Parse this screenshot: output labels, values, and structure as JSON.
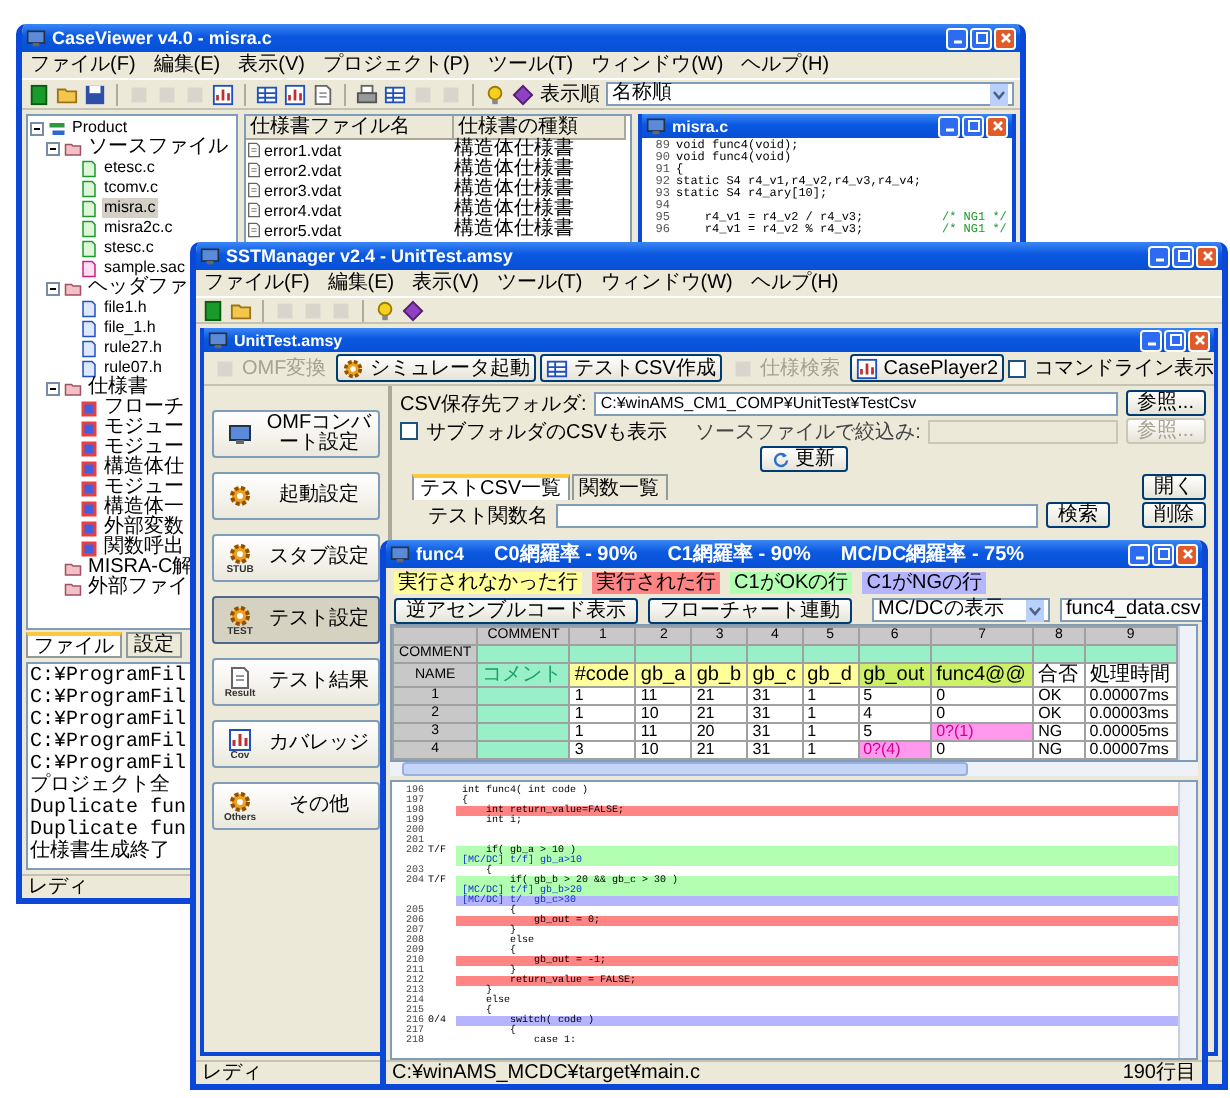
{
  "case_viewer": {
    "title": "CaseViewer v4.0 - misra.c",
    "menu": [
      "ファイル(F)",
      "編集(E)",
      "表示(V)",
      "プロジェクト(P)",
      "ツール(T)",
      "ウィンドウ(W)",
      "ヘルプ(H)"
    ],
    "sort": {
      "label": "表示順",
      "value": "名称順"
    },
    "tree": [
      {
        "label": "Product",
        "kind": "project",
        "expanded": true,
        "selected": false,
        "children": [
          {
            "label": "ソースファイル",
            "kind": "folder",
            "expanded": true,
            "selected": false,
            "children": [
              {
                "label": "etesc.c",
                "kind": "source",
                "selected": false
              },
              {
                "label": "tcomv.c",
                "kind": "source",
                "selected": false
              },
              {
                "label": "misra.c",
                "kind": "source",
                "selected": true
              },
              {
                "label": "misra2c.c",
                "kind": "source",
                "selected": false
              },
              {
                "label": "stesc.c",
                "kind": "source",
                "selected": false
              },
              {
                "label": "sample.sac",
                "kind": "sample",
                "selected": false
              }
            ]
          },
          {
            "label": "ヘッダファ",
            "kind": "folder",
            "expanded": true,
            "selected": false,
            "children": [
              {
                "label": "file1.h",
                "kind": "header",
                "selected": false
              },
              {
                "label": "file_1.h",
                "kind": "header",
                "selected": false
              },
              {
                "label": "rule27.h",
                "kind": "header",
                "selected": false
              },
              {
                "label": "rule07.h",
                "kind": "header",
                "selected": false
              }
            ]
          },
          {
            "label": "仕様書",
            "kind": "folder",
            "expanded": true,
            "selected": false,
            "children": [
              {
                "label": "フローチ",
                "kind": "spec",
                "selected": false
              },
              {
                "label": "モジュー",
                "kind": "spec",
                "selected": false
              },
              {
                "label": "モジュー",
                "kind": "spec",
                "selected": false
              },
              {
                "label": "構造体仕",
                "kind": "spec",
                "selected": false
              },
              {
                "label": "モジュー",
                "kind": "spec",
                "selected": false
              },
              {
                "label": "構造体一",
                "kind": "spec",
                "selected": false
              },
              {
                "label": "外部変数",
                "kind": "spec",
                "selected": false
              },
              {
                "label": "関数呼出",
                "kind": "spec",
                "selected": false
              }
            ]
          },
          {
            "label": "MISRA-C解",
            "kind": "folder",
            "selected": false
          },
          {
            "label": "外部ファイ",
            "kind": "folder",
            "selected": false
          }
        ]
      }
    ],
    "spec_list": {
      "columns": [
        "仕様書ファイル名",
        "仕様書の種類"
      ],
      "rows": [
        [
          "error1.vdat",
          "構造体仕様書"
        ],
        [
          "error2.vdat",
          "構造体仕様書"
        ],
        [
          "error3.vdat",
          "構造体仕様書"
        ],
        [
          "error4.vdat",
          "構造体仕様書"
        ],
        [
          "error5.vdat",
          "構造体仕様書"
        ]
      ]
    },
    "editor": {
      "title": "misra.c",
      "lines": [
        {
          "number": "89",
          "code": "void func4(void);"
        },
        {
          "number": "90",
          "code": "void func4(void)"
        },
        {
          "number": "91",
          "code": "{"
        },
        {
          "number": "92",
          "code": "static S4 r4_v1,r4_v2,r4_v3,r4_v4;"
        },
        {
          "number": "93",
          "code": "static S4 r4_ary[10];"
        },
        {
          "number": "94"
        },
        {
          "number": "95",
          "code": "    r4_v1 = r4_v2 / r4_v3;",
          "comment": "/* NG1 */"
        },
        {
          "number": "96",
          "code": "    r4_v1 = r4_v2 % r4_v3;",
          "comment": "/* NG1 */"
        }
      ]
    },
    "bottom_tabs": [
      {
        "label": "ファイル",
        "selected": true
      },
      {
        "label": "設定",
        "selected": false
      }
    ],
    "log": [
      "C:¥ProgramFil",
      "C:¥ProgramFil",
      "C:¥ProgramFil",
      "C:¥ProgramFil",
      "C:¥ProgramFil",
      "プロジェクト全",
      "Duplicate fun",
      "Duplicate fun",
      "仕様書生成終了"
    ],
    "status": "レディ"
  },
  "sst_manager": {
    "title": "SSTManager v2.4 - UnitTest.amsy",
    "menu": [
      "ファイル(F)",
      "編集(E)",
      "表示(V)",
      "ツール(T)",
      "ウィンドウ(W)",
      "ヘルプ(H)"
    ],
    "child_title": "UnitTest.amsy",
    "toolbar": [
      {
        "label": "OMF変換",
        "disabled": true
      },
      {
        "label": "シミュレータ起動",
        "disabled": false
      },
      {
        "label": "テストCSV作成",
        "disabled": false
      },
      {
        "label": "仕様検索",
        "disabled": true
      },
      {
        "label": "CasePlayer2",
        "disabled": false
      }
    ],
    "command_line": {
      "label": "コマンドライン表示",
      "checked": false
    },
    "side_buttons": [
      {
        "label": "OMFコンバート設定",
        "selected": false
      },
      {
        "label": "起動設定",
        "selected": false
      },
      {
        "label": "スタブ設定",
        "icon_text": "STUB",
        "selected": false
      },
      {
        "label": "テスト設定",
        "icon_text": "TEST",
        "selected": true
      },
      {
        "label": "テスト結果",
        "icon_text": "Result",
        "selected": false
      },
      {
        "label": "カバレッジ",
        "icon_text": "Cov",
        "selected": false
      },
      {
        "label": "その他",
        "icon_text": "Others",
        "selected": false
      }
    ],
    "csv_folder": {
      "label": "CSV保存先フォルダ:",
      "value": "C:¥winAMS_CM1_COMP¥UnitTest¥TestCsv",
      "button": "参照..."
    },
    "subfolder": {
      "label": "サブフォルダのCSVも表示",
      "checked": false
    },
    "source_filter": {
      "label": "ソースファイルで絞込み:",
      "button": "参照...",
      "disabled": true
    },
    "update_button": "更新",
    "tabs": [
      {
        "label": "テストCSV一覧",
        "selected": true
      },
      {
        "label": "関数一覧",
        "selected": false
      }
    ],
    "open_button": "開く",
    "test_function": {
      "label": "テスト関数名",
      "button": "検索"
    },
    "delete_button": "削除",
    "status": "レディ"
  },
  "coverage": {
    "title": "func4",
    "rates": [
      "C0網羅率 - 90%",
      "C1網羅率 - 90%",
      "MC/DC網羅率 - 75%"
    ],
    "legend": [
      {
        "label": "実行されなかった行",
        "kind": "not_executed"
      },
      {
        "label": "実行された行",
        "kind": "executed"
      },
      {
        "label": "C1がOKの行",
        "kind": "c1_ok"
      },
      {
        "label": "C1がNGの行",
        "kind": "c1_ng"
      }
    ],
    "buttons": [
      "逆アセンブルコード表示",
      "フローチャート連動"
    ],
    "dropdowns": [
      "MC/DCの表示",
      "func4_data.csv"
    ],
    "table": {
      "columns": [
        "COMMENT",
        "1",
        "2",
        "3",
        "4",
        "5",
        "6",
        "7",
        "8",
        "9"
      ],
      "rows": [
        {
          "header": "COMMENT",
          "kind": "comment"
        },
        {
          "header": "NAME",
          "kind": "names",
          "comment": "コメント",
          "cells": [
            {
              "text": "#code",
              "kind": "input"
            },
            {
              "text": "gb_a",
              "kind": "input"
            },
            {
              "text": "gb_b",
              "kind": "input"
            },
            {
              "text": "gb_c",
              "kind": "input"
            },
            {
              "text": "gb_d",
              "kind": "input"
            },
            {
              "text": "gb_out",
              "kind": "output"
            },
            {
              "text": "func4@@",
              "kind": "output"
            },
            {
              "text": "合否",
              "kind": "result"
            },
            {
              "text": "処理時間",
              "kind": "result"
            }
          ]
        },
        {
          "header": "1",
          "kind": "data",
          "cells": [
            {
              "text": "1",
              "mismatch": false
            },
            {
              "text": "11",
              "mismatch": false
            },
            {
              "text": "21",
              "mismatch": false
            },
            {
              "text": "31",
              "mismatch": false
            },
            {
              "text": "1",
              "mismatch": false
            },
            {
              "text": "5",
              "mismatch": false
            },
            {
              "text": "0",
              "mismatch": false
            },
            {
              "text": "OK",
              "mismatch": false
            },
            {
              "text": "0.00007ms",
              "mismatch": false
            }
          ]
        },
        {
          "header": "2",
          "kind": "data",
          "cells": [
            {
              "text": "1",
              "mismatch": false
            },
            {
              "text": "10",
              "mismatch": false
            },
            {
              "text": "21",
              "mismatch": false
            },
            {
              "text": "31",
              "mismatch": false
            },
            {
              "text": "1",
              "mismatch": false
            },
            {
              "text": "4",
              "mismatch": false
            },
            {
              "text": "0",
              "mismatch": false
            },
            {
              "text": "OK",
              "mismatch": false
            },
            {
              "text": "0.00003ms",
              "mismatch": false
            }
          ]
        },
        {
          "header": "3",
          "kind": "data",
          "cells": [
            {
              "text": "1",
              "mismatch": false
            },
            {
              "text": "11",
              "mismatch": false
            },
            {
              "text": "20",
              "mismatch": false
            },
            {
              "text": "31",
              "mismatch": false
            },
            {
              "text": "1",
              "mismatch": false
            },
            {
              "text": "5",
              "mismatch": false
            },
            {
              "text": "0?(1)",
              "mismatch": true
            },
            {
              "text": "NG",
              "mismatch": false
            },
            {
              "text": "0.00005ms",
              "mismatch": false
            }
          ]
        },
        {
          "header": "4",
          "kind": "data",
          "cells": [
            {
              "text": "3",
              "mismatch": false
            },
            {
              "text": "10",
              "mismatch": false
            },
            {
              "text": "21",
              "mismatch": false
            },
            {
              "text": "31",
              "mismatch": false
            },
            {
              "text": "1",
              "mismatch": false
            },
            {
              "text": "0?(4)",
              "mismatch": true
            },
            {
              "text": "0",
              "mismatch": false
            },
            {
              "text": "NG",
              "mismatch": false
            },
            {
              "text": "0.00007ms",
              "mismatch": false
            }
          ]
        }
      ]
    },
    "code": [
      {
        "number": "196",
        "code": "int func4( int code )",
        "kind": "plain"
      },
      {
        "number": "197",
        "code": "{",
        "kind": "plain"
      },
      {
        "number": "198",
        "code": "    int return_value=FALSE;",
        "kind": "executed"
      },
      {
        "number": "199",
        "code": "    int i;",
        "kind": "plain"
      },
      {
        "number": "200",
        "kind": "plain"
      },
      {
        "number": "201",
        "kind": "plain"
      },
      {
        "number": "202",
        "branch": "T/F",
        "code": "    if( gb_a > 10 )",
        "kind": "c1_ok"
      },
      {
        "code": "[MC/DC] t/f] gb_a>10",
        "kind": "c1_ok"
      },
      {
        "number": "203",
        "code": "    {",
        "kind": "plain"
      },
      {
        "number": "204",
        "branch": "T/F",
        "code": "        if( gb_b > 20 && gb_c > 30 )",
        "kind": "c1_ok"
      },
      {
        "code": "[MC/DC] t/f] gb_b>20",
        "kind": "c1_ok"
      },
      {
        "code": "[MC/DC] t/  gb_c>30",
        "kind": "c1_ng"
      },
      {
        "number": "205",
        "code": "        {",
        "kind": "plain"
      },
      {
        "number": "206",
        "code": "            gb_out = 0;",
        "kind": "executed"
      },
      {
        "number": "207",
        "code": "        }",
        "kind": "plain"
      },
      {
        "number": "208",
        "code": "        else",
        "kind": "plain"
      },
      {
        "number": "209",
        "code": "        {",
        "kind": "plain"
      },
      {
        "number": "210",
        "code": "            gb_out = -1;",
        "kind": "executed"
      },
      {
        "number": "211",
        "code": "        }",
        "kind": "plain"
      },
      {
        "number": "212",
        "code": "        return_value = FALSE;",
        "kind": "executed"
      },
      {
        "number": "213",
        "code": "    }",
        "kind": "plain"
      },
      {
        "number": "214",
        "code": "    else",
        "kind": "plain"
      },
      {
        "number": "215",
        "code": "    {",
        "kind": "plain"
      },
      {
        "number": "216",
        "branch": "0/4",
        "code": "        switch( code )",
        "kind": "c1_ng"
      },
      {
        "number": "217",
        "code": "        {",
        "kind": "plain"
      },
      {
        "number": "218",
        "code": "            case 1:",
        "kind": "plain"
      }
    ],
    "status": {
      "path": "C:¥winAMS_MCDC¥target¥main.c",
      "line": "190行目"
    }
  }
}
